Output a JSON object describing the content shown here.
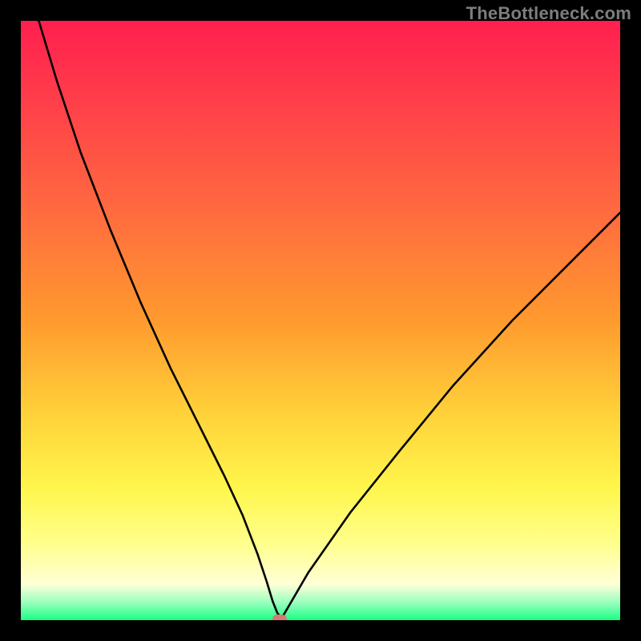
{
  "watermark": "TheBottleneck.com",
  "chart_data": {
    "type": "line",
    "title": "",
    "xlabel": "",
    "ylabel": "",
    "xlim": [
      0,
      100
    ],
    "ylim": [
      0,
      100
    ],
    "grid": false,
    "legend": false,
    "series": [
      {
        "name": "bottleneck-curve",
        "x": [
          3,
          6,
          10,
          15,
          20,
          25,
          30,
          34,
          37,
          39.5,
          41,
          42,
          42.8,
          43.5,
          44.5,
          48,
          55,
          63,
          72,
          82,
          92,
          100
        ],
        "y": [
          100,
          90,
          78,
          65,
          53,
          42,
          32,
          24,
          17.5,
          11,
          6.5,
          3.2,
          1.2,
          0.3,
          2,
          8,
          18,
          28,
          39,
          50,
          60,
          68
        ]
      }
    ],
    "marker": {
      "x": 43.2,
      "y": 0.2,
      "color": "#d77a77"
    },
    "gradient_stops": [
      {
        "pct": 0,
        "color": "#ff1f4f"
      },
      {
        "pct": 12,
        "color": "#ff3b4a"
      },
      {
        "pct": 32,
        "color": "#ff6b3f"
      },
      {
        "pct": 50,
        "color": "#ff9a2e"
      },
      {
        "pct": 66,
        "color": "#ffd33a"
      },
      {
        "pct": 78,
        "color": "#fff64c"
      },
      {
        "pct": 87,
        "color": "#ffff8a"
      },
      {
        "pct": 94,
        "color": "#ffffd7"
      },
      {
        "pct": 97,
        "color": "#9cffbf"
      },
      {
        "pct": 100,
        "color": "#1bff84"
      }
    ]
  }
}
